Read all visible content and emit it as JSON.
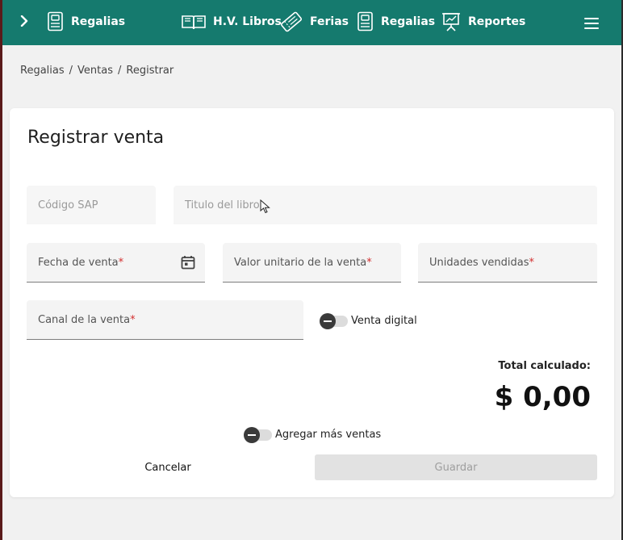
{
  "colors": {
    "topbar_bg": "#157a6e",
    "required_asterisk": "#d32f2f",
    "page_bg": "#f1f1f1",
    "card_bg": "#ffffff"
  },
  "topbar": {
    "expand_icon": "chevron-right-icon",
    "brand": {
      "icon": "ledger-icon",
      "label": "Regalias"
    },
    "nav": [
      {
        "icon": "open-book-icon",
        "label": "H.V. Libros"
      },
      {
        "icon": "ticket-icon",
        "label": "Ferias"
      },
      {
        "icon": "ledger-icon",
        "label": "Regalias"
      },
      {
        "icon": "presentation-chart-icon",
        "label": "Reportes"
      }
    ],
    "menu_icon": "hamburger-menu-icon"
  },
  "breadcrumb": {
    "items": [
      "Regalias",
      "Ventas",
      "Registrar"
    ],
    "separator": "/"
  },
  "form": {
    "title": "Registrar venta",
    "fields": {
      "codigo_sap": {
        "label": "Código SAP",
        "value": ""
      },
      "titulo_libro": {
        "label": "Titulo del libro",
        "value": ""
      },
      "fecha_venta": {
        "label": "Fecha de venta",
        "required_mark": "*",
        "icon": "calendar-icon"
      },
      "valor_unitario": {
        "label": "Valor unitario de la venta",
        "required_mark": "*"
      },
      "unidades_vendidas": {
        "label": "Unidades vendidas",
        "required_mark": "*"
      },
      "canal_venta": {
        "label": "Canal de la venta",
        "required_mark": "*"
      }
    },
    "venta_digital_toggle": {
      "label": "Venta digital",
      "checked": false
    },
    "total": {
      "label": "Total calculado:",
      "value": "$ 0,00"
    },
    "agregar_mas_toggle": {
      "label": "Agregar más ventas",
      "checked": false
    },
    "buttons": {
      "cancel": "Cancelar",
      "save": "Guardar"
    }
  }
}
